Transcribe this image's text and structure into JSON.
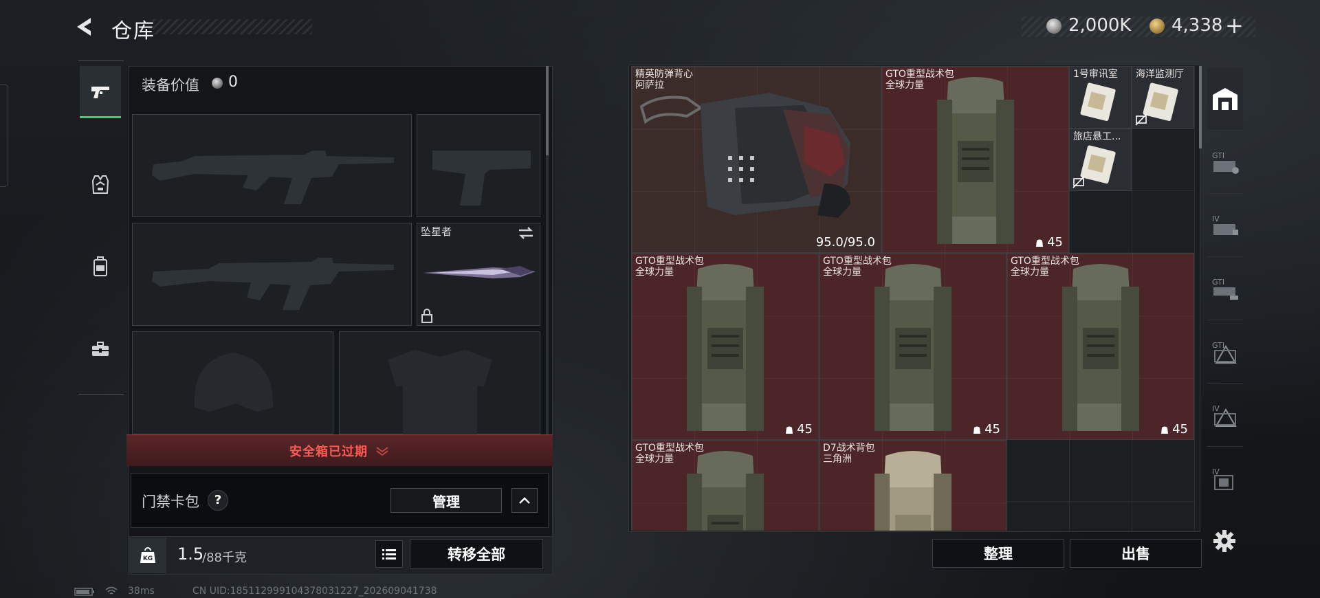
{
  "header": {
    "title": "仓库",
    "currency": [
      {
        "name": "hafu-coin",
        "value": "2,000K"
      },
      {
        "name": "triangle-coin",
        "value": "4,338"
      }
    ],
    "add_label": "+"
  },
  "left_rail": {
    "tabs": [
      {
        "icon": "pistol-icon",
        "active": true
      },
      {
        "icon": "vest-icon",
        "active": false
      },
      {
        "icon": "backpack-icon",
        "active": false
      },
      {
        "icon": "toolbox-icon",
        "active": false
      }
    ]
  },
  "loadout": {
    "value_label": "装备价值",
    "value": "0",
    "melee": {
      "name": "坠星者"
    },
    "safe_box_expired": "安全箱已过期",
    "keycard_label": "门禁卡包",
    "help_label": "?",
    "manage_label": "管理",
    "weight_value": "1.5",
    "weight_max": "/88千克",
    "weight_icon_text": "KG",
    "transfer_all_label": "转移全部"
  },
  "stash": {
    "items": [
      {
        "name": "精英防弹背心",
        "sub": "阿萨拉",
        "durability": "95.0/95.0"
      },
      {
        "name": "GTO重型战术包",
        "sub": "全球力量",
        "qty": "45"
      },
      {
        "name": "1号审讯室",
        "sub": ""
      },
      {
        "name": "海洋监测厅",
        "sub": ""
      },
      {
        "name": "旅店悬工...",
        "sub": ""
      },
      {
        "name": "GTO重型战术包",
        "sub": "全球力量",
        "qty": "45"
      },
      {
        "name": "GTO重型战术包",
        "sub": "全球力量",
        "qty": "45"
      },
      {
        "name": "GTO重型战术包",
        "sub": "全球力量",
        "qty": "45"
      },
      {
        "name": "GTO重型战术包",
        "sub": "全球力量"
      },
      {
        "name": "D7战术背包",
        "sub": "三角洲"
      }
    ],
    "sort_label": "整理",
    "sell_label": "出售"
  },
  "right_rail": {
    "tabs": [
      {
        "label": "",
        "icon": "home-icon",
        "active": true
      },
      {
        "label": "GTI",
        "icon": "storage-gti-1-icon"
      },
      {
        "label": "IV",
        "icon": "storage-iv-1-icon"
      },
      {
        "label": "GTI",
        "icon": "storage-gti-2-icon"
      },
      {
        "label": "GTI",
        "icon": "storage-gti-3-icon"
      },
      {
        "label": "IV",
        "icon": "storage-iv-2-icon"
      },
      {
        "label": "IV",
        "icon": "storage-iv-3-icon"
      }
    ]
  },
  "footer": {
    "ping": "38ms",
    "uid": "CN UID:18511299910437803122​7_202609041738"
  }
}
